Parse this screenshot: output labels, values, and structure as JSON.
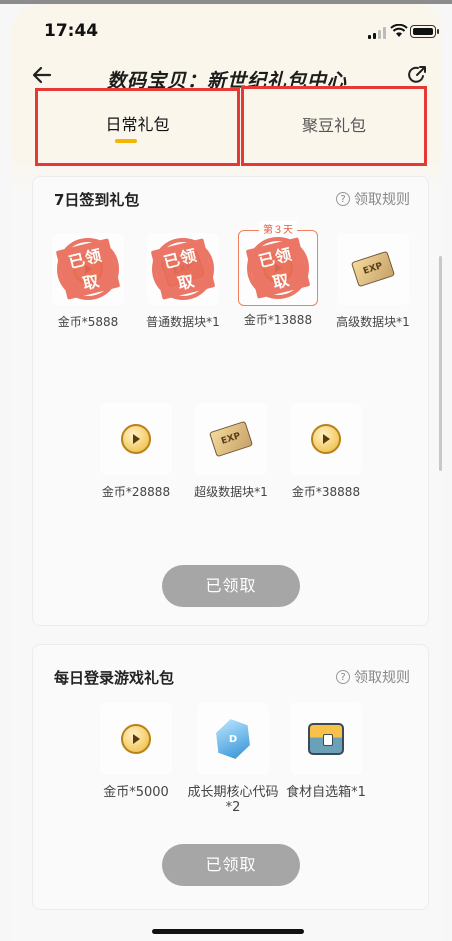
{
  "status": {
    "time": "17:44"
  },
  "header": {
    "title": "数码宝贝：新世纪礼包中心"
  },
  "tabs": [
    {
      "label": "日常礼包",
      "active": true
    },
    {
      "label": "聚豆礼包",
      "active": false
    }
  ],
  "sign_in": {
    "title": "7日签到礼包",
    "rules_label": "领取规则",
    "current_day_tag": "第３天",
    "claimed_stamp_text": "已领取",
    "items": [
      {
        "label": "金币*5888",
        "icon": "coin-icon",
        "claimed": true
      },
      {
        "label": "普通数据块*1",
        "icon": "data-block-icon",
        "claimed": true
      },
      {
        "label": "金币*13888",
        "icon": "coin-icon",
        "claimed": true,
        "current": true
      },
      {
        "label": "高级数据块*1",
        "icon": "data-block-icon",
        "claimed": false
      },
      {
        "label": "金币*28888",
        "icon": "coin-icon",
        "claimed": false
      },
      {
        "label": "超级数据块*1",
        "icon": "data-block-icon",
        "claimed": false
      },
      {
        "label": "金币*38888",
        "icon": "coin-icon",
        "claimed": false
      }
    ],
    "button_label": "已领取"
  },
  "daily_login": {
    "title": "每日登录游戏礼包",
    "rules_label": "领取规则",
    "items": [
      {
        "label": "金币*5000",
        "icon": "coin-icon"
      },
      {
        "label": "成长期核心代码*2",
        "icon": "core-code-icon"
      },
      {
        "label": "食材自选箱*1",
        "icon": "chest-icon"
      }
    ],
    "button_label": "已领取"
  },
  "colors": {
    "accent": "#f5b400",
    "stamp": "#ea6b5a",
    "button_disabled": "#a6a6a6",
    "highlight_box": "#e53935"
  }
}
